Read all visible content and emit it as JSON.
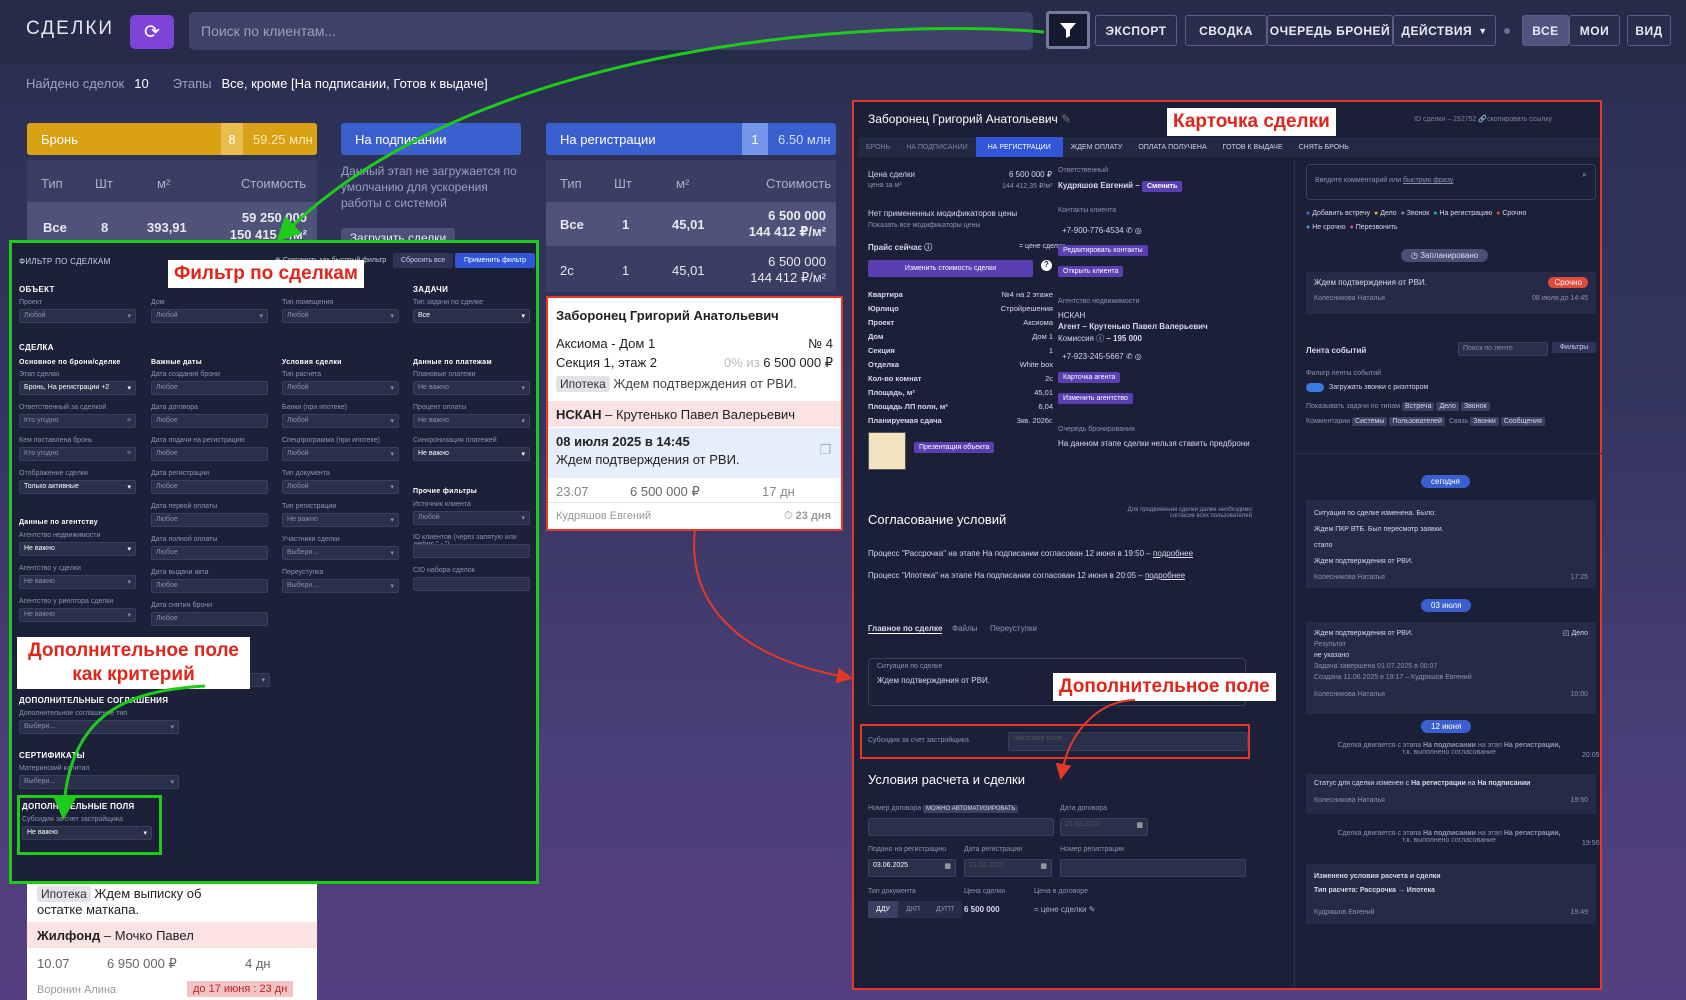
{
  "topbar": {
    "logo": "СДЕЛКИ",
    "search_placeholder": "Поиск по клиентам...",
    "export": "ЭКСПОРТ",
    "summary": "СВОДКА",
    "queue": "ОЧЕРЕДЬ БРОНЕЙ",
    "actions": "ДЕЙСТВИЯ",
    "all": "ВСЕ",
    "mine": "МОИ",
    "view": "ВИД"
  },
  "infobar": {
    "found_label": "Найдено сделок",
    "found_count": "10",
    "stages_label": "Этапы",
    "stages_value": "Все, кроме [На подписании, Готов к выдаче]"
  },
  "stages": {
    "bron": {
      "title": "Бронь",
      "count": "8",
      "sum": "59.25 млн"
    },
    "podpis": {
      "title": "На подписании",
      "note": "Данный этап не загружается по умолчанию для ускорения работы с системой",
      "load": "Загрузить сделки"
    },
    "reg": {
      "title": "На регистрации",
      "count": "1",
      "sum": "6.50 млн"
    }
  },
  "table": {
    "h_type": "Тип",
    "h_qty": "Шт",
    "h_m2": "м²",
    "h_cost": "Стоимость"
  },
  "bron_row": {
    "type": "Все",
    "qty": "8",
    "m2": "393,91",
    "cost": "59 250 000",
    "cost2": "150 415 ₽/м²"
  },
  "reg_rows": [
    {
      "type": "Все",
      "qty": "1",
      "m2": "45,01",
      "cost": "6 500 000",
      "cost2": "144 412 ₽/м²"
    },
    {
      "type": "2с",
      "qty": "1",
      "m2": "45,01",
      "cost": "6 500 000",
      "cost2": "144 412 ₽/м²"
    }
  ],
  "deal_card": {
    "name": "Заборонец Григорий Анатольевич",
    "project": "Аксиома - Дом 1",
    "num": "№ 4",
    "section": "Секция 1, этаж 2",
    "pct": "0% из",
    "price": "6 500 000 ₽",
    "tag": "Ипотека",
    "status": "Ждем подтверждения от РВИ.",
    "agency": "НСКАН",
    "agent": "– Крутенько Павел Валерьевич",
    "date": "08 июля 2025 в 14:45",
    "task": "Ждем подтверждения от РВИ.",
    "d1": "23.07",
    "d2": "6 500 000 ₽",
    "d3": "17 дн",
    "manager": "Кудряшов Евгений",
    "days": "23 дня"
  },
  "bottom_card": {
    "tag": "Ипотека",
    "text": "Ждем выписку об остатке маткапа.",
    "agency": "Жилфонд",
    "agent": "– Мочко Павел",
    "d1": "10.07",
    "d2": "6 950 000 ₽",
    "d3": "4 дн",
    "manager": "Воронин Алина",
    "due": "до 17 июня : 23 дн"
  },
  "callouts": {
    "filter": "Фильтр по сделкам",
    "card": "Карточка сделки",
    "extra_crit": "Дополнительное поле\nкак критерий",
    "extra_field": "Дополнительное поле"
  },
  "filter": {
    "title": "ФИЛЬТР ПО СДЕЛКАМ",
    "save": "Сохранить как быстрый фильтр",
    "reset": "Сбросить все",
    "apply": "Применить фильтр",
    "object": "ОБЪЕКТ",
    "tasks": "ЗАДАЧИ",
    "deal": "СДЕЛКА",
    "project": "Проект",
    "house": "Дом",
    "room_type": "Тип помещения",
    "task_type": "Тип задачи по сделке",
    "any": "Любой",
    "any2": "Любое",
    "all": "Все",
    "col1": "Основное по брони/сделке",
    "col2": "Важные даты",
    "col3": "Условия сделки",
    "col4": "Данные по платежам",
    "stage_lbl": "Этап сделки",
    "stage_val": "Бронь, На регистрации +2",
    "resp_lbl": "Ответственный за сделкой",
    "who": "Кто угодно",
    "setby_lbl": "Кем поставлена бронь",
    "display_lbl": "Отображение сделки",
    "display_val": "Только активные",
    "d1": "Дата создания брони",
    "d2": "Дата договора",
    "d3": "Дата подачи на регистрацию",
    "d4": "Дата регистрации",
    "d5": "Дата первой оплаты",
    "d6": "Дата полной оплаты",
    "d7": "Дата выдачи акта",
    "d8": "Дата снятия брони",
    "c1": "Тип расчета",
    "c2": "Банки (при ипотеке)",
    "c3": "Спецпрограмма (при ипотеке)",
    "c4": "Тип документа",
    "c5": "Тип регистрации",
    "c6": "Участники сделки",
    "c7": "Переуступка",
    "p1": "Плановые платежи",
    "p2": "Процент оплаты",
    "p3": "Синхронизация платежей",
    "no_matter": "Не важно",
    "choose": "Выбери...",
    "other": "Прочие фильтры",
    "source": "Источник клиента",
    "client_ids": "ID клиентов (через запятую или дефис \" - \")",
    "cid": "CID набора сделок",
    "agency": "Данные по агентству",
    "ag1": "Агентство недвижимости",
    "ag2": "Агентство у сделки",
    "ag3": "Агентство у риелтора сделки",
    "add_agr": "ДОПОЛНИТЕЛЬНЫЕ СОГЛАШЕНИЯ",
    "add_agr_lbl": "Дополнительное соглашение тип",
    "certs": "СЕРТИФИКАТЫ",
    "certs_lbl": "Материнский капитал",
    "addf": "ДОПОЛНИТЕЛЬНЫЕ ПОЛЯ",
    "subsidy": "Субсидия за счет застройщика"
  },
  "card": {
    "name": "Заборонец Григорий Анатольевич",
    "id_label": "ID сделки – 292752",
    "copy": "скопировать ссылку",
    "steps": [
      "БРОНЬ",
      "НА ПОДПИСАНИИ",
      "НА РЕГИСТРАЦИИ",
      "ЖДЕМ ОПЛАТУ",
      "ОПЛАТА ПОЛУЧЕНА",
      "ГОТОВ К ВЫДАЧЕ",
      "СНЯТЬ БРОНЬ"
    ],
    "price_lbl": "Цена сделки",
    "price": "6 500 000 ₽",
    "price_m": "цена за м²",
    "price_m_val": "144 412,35 ₽/м²",
    "no_mods": "Нет примененных модификаторов цены",
    "show_mods": "Показать все модификаторы цены",
    "pricelist": "Прайс сейчас",
    "eq": "= цене сделки",
    "change_price": "Изменить стоимость сделки",
    "props": [
      [
        "Квартира",
        "№4 на 2 этаже"
      ],
      [
        "Юрлицо",
        "Стройрешения"
      ],
      [
        "Проект",
        "Аксиома"
      ],
      [
        "Дом",
        "Дом 1"
      ],
      [
        "Секция",
        "1"
      ],
      [
        "Отделка",
        "White box"
      ],
      [
        "Кол-во комнат",
        "2с"
      ],
      [
        "Площадь, м²",
        "45,01"
      ],
      [
        "Площадь ЛП полн, м²",
        "6,04"
      ],
      [
        "Планируемая сдача",
        "3кв. 2026г."
      ]
    ],
    "present": "Презентация объекта",
    "resp_lbl": "Ответственный",
    "resp": "Кудряшов Евгений –",
    "change": "Сменить",
    "contacts_lbl": "Контакты клиента",
    "phone": "+7-900-776-4534",
    "edit_contacts": "Редактировать контакты",
    "open_client": "Открыть клиента",
    "agency_lbl": "Агентство недвижимости",
    "agency": "НСКАН",
    "agent": "Агент – Крутенько Павел Валерьевич",
    "commission": "Комиссия",
    "commission_val": "– 195 000",
    "agent_phone": "+7-923-245-5667",
    "agent_card": "Карточка агента",
    "change_agency": "Изменить агентство",
    "queue_lbl": "Очередь бронирования",
    "queue_txt": "На данном этапе сделки нельзя ставить предброни",
    "comment_ph": "Введите комментарий или",
    "quick": "быструю фразу",
    "quick_tags": [
      "Добавить встречу",
      "Дело",
      "Звонок",
      "На регистрацию",
      "Срочно",
      "Не срочно",
      "Перезвонить"
    ],
    "planned": "Запланировано",
    "task_txt": "Ждем подтверждения от РВИ.",
    "urgent": "Срочно",
    "task_author": "Колесникова Наталья",
    "task_due": "08 июля до 14:45",
    "feed": "Лента событий",
    "feed_search": "Поиск по ленте",
    "filters": "Фильтры",
    "feed_filter": "Фильтр ленты событий",
    "load_calls": "Загружать звонки с риэлтором",
    "show_tasks": "Показывать задачи по типам",
    "t_meet": "Встреча",
    "t_deal": "Дело",
    "t_call": "Звонок",
    "comments": "Комментарии",
    "c_sys": "Системы",
    "c_users": "Пользователей",
    "link": "Связь",
    "l_call": "Звонки",
    "l_msg": "Сообщения",
    "today": "сегодня",
    "ev1_a": "Ситуация по сделке изменена. Было:",
    "ev1_b": "Ждем ПКР ВТБ. Был пересмотр заявки.",
    "ev1_c": "стало",
    "ev1_d": "Ждем подтверждения от РВИ.",
    "ev1_who": "Колесникова Наталья",
    "ev1_t": "17:25",
    "jul3": "03 июля",
    "ev2_a": "Ждем подтверждения от РВИ.",
    "ev2_tag": "Дело",
    "ev2_res": "Результат",
    "ev2_res_v": "не указано",
    "ev2_done": "Задача завершена 01.07.2025 в 00:07",
    "ev2_created": "Создана 11.06.2025 в 19:17 – Кудряшов Евгений",
    "ev2_who": "Колесникова Наталья",
    "ev2_t": "10:00",
    "jun12": "12 июня",
    "ev3_a": "Сделка двигается с этапа",
    "ev3_b": "На подписании",
    "ev3_c": "на этап",
    "ev3_d": "На регистрации,",
    "ev3_e": "т.к. выполнено согласование",
    "ev3_t": "20:05",
    "ev4_a": "Статус для сделки изменен с",
    "ev4_b": "На регистрации",
    "ev4_c": "на",
    "ev4_d": "На подписании",
    "ev4_who": "Колесникова Наталья",
    "ev4_t": "19:50",
    "ev5_t": "19:50",
    "ev6_a": "Изменено условия расчета и сделки",
    "ev6_b": "Тип расчета: Рассрочка → Ипотека",
    "ev6_who": "Кудряшов Евгений",
    "ev6_t": "19:49",
    "agree": "Согласование условий",
    "agree_note": "Для продвижения сделки далее необходимо согласие всех пользователей",
    "proc1": "Процесс \"Рассрочка\" на этапе На подписании согласован 12 июня в 19:50 –",
    "proc2": "Процесс \"Ипотека\" на этапе На подписании согласован 12 июня в 20:05 –",
    "more": "подробнее",
    "tab_main": "Главное по сделке",
    "tab_files": "Файлы",
    "tab_reassign": "Переуступки",
    "situation_lbl": "Ситуация по сделке",
    "situation": "Ждем подтверждения от РВИ.",
    "subsidy": "Субсидия за счет застройщика",
    "numeric": "Числовое поле...",
    "calc": "Условия расчета и сделки",
    "contract_no": "Номер договора",
    "auto": "МОЖНО АВТОМАТИЗИРОВАТЬ",
    "contract_date": "Дата договора",
    "date_ph": "21.02.2020",
    "filed": "Подано на регистрацию",
    "filed_val": "03.06.2025",
    "reg_date": "Дата регистрации",
    "reg_no": "Номер регистрации",
    "doc_type": "Тип документа",
    "ddu": "ДДУ",
    "dkp": "ДКП",
    "dupt": "ДУПТ",
    "deal_price": "Цена сделки",
    "deal_price_val": "6 500 000",
    "contract_price": "Цена в договоре",
    "eq2": "= цене сделки"
  }
}
